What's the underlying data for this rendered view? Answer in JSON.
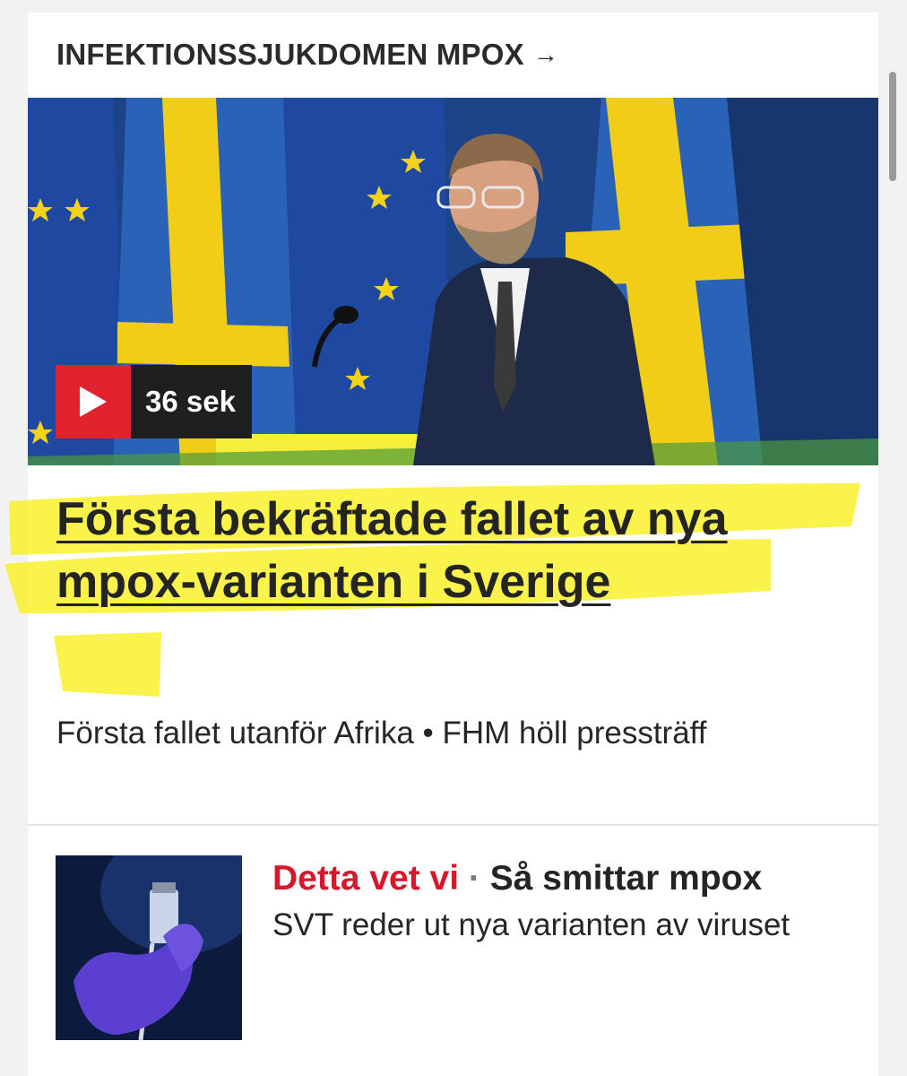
{
  "topic": {
    "label": "INFEKTIONSSJUKDOMEN MPOX",
    "arrow": "→"
  },
  "hero": {
    "image_description_icon": "press-conference-photo",
    "video_duration": "36 sek"
  },
  "article": {
    "headline": "Första bekräftade fallet av nya mpox-varianten i Sverige",
    "subline": "Första fallet utanför Afrika • FHM höll pressträff"
  },
  "related": {
    "kicker": "Detta vet vi",
    "separator": " · ",
    "title": "Så smittar mpox",
    "description": "SVT reder ut nya varianten av viruset",
    "thumbnail_icon": "vaccine-vial-photo"
  },
  "colors": {
    "accent_red": "#e2232e",
    "kicker_red": "#d6182c",
    "highlight_yellow": "#f7f01e",
    "text": "#242424"
  }
}
